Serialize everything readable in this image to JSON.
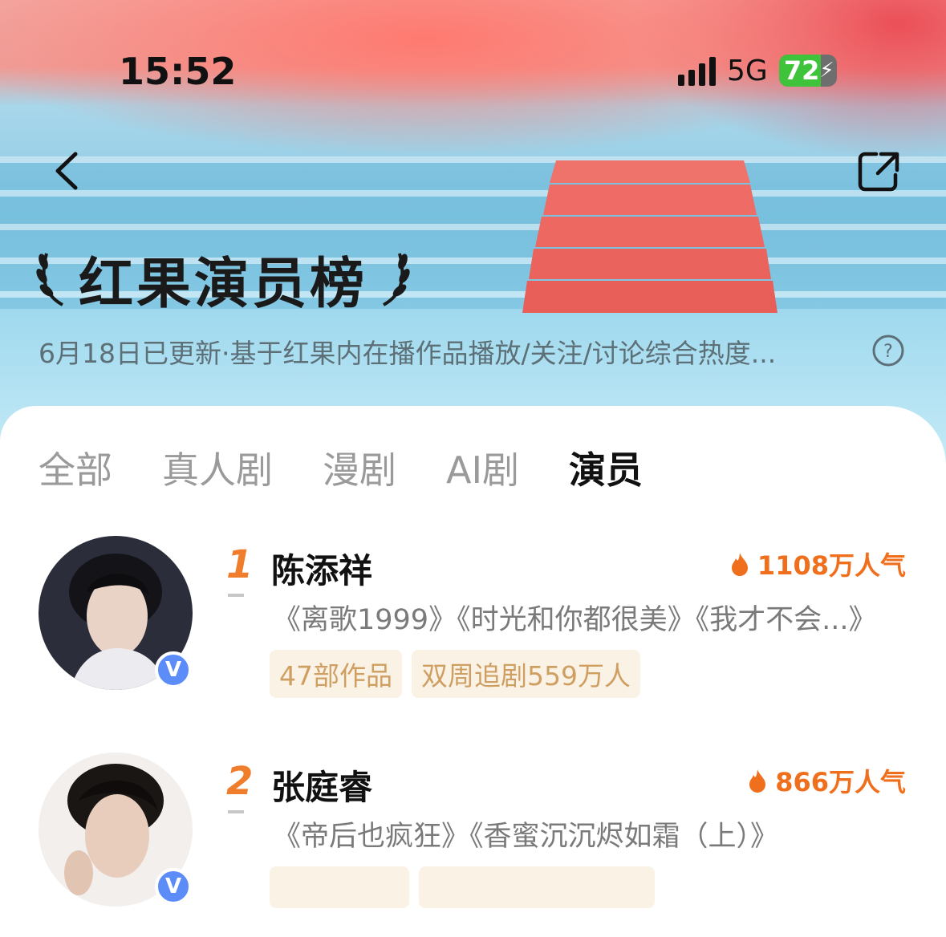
{
  "status_bar": {
    "time": "15:52",
    "network": "5G",
    "battery": "72"
  },
  "header": {
    "title": "红果演员榜",
    "subtitle": "6月18日已更新·基于红果内在播作品播放/关注/讨论综合热度..."
  },
  "tabs": [
    {
      "label": "全部",
      "active": false
    },
    {
      "label": "真人剧",
      "active": false
    },
    {
      "label": "漫剧",
      "active": false
    },
    {
      "label": "AI剧",
      "active": false
    },
    {
      "label": "演员",
      "active": true
    }
  ],
  "actors": [
    {
      "rank": "1",
      "name": "陈添祥",
      "heat": "1108万人气",
      "works": "《离歌1999》《时光和你都很美》《我才不会...》",
      "tags": [
        "47部作品",
        "双周追剧559万人"
      ],
      "verified_badge": "V"
    },
    {
      "rank": "2",
      "name": "张庭睿",
      "heat": "866万人气",
      "works": "《帝后也疯狂》《香蜜沉沉烬如霜（上）》",
      "tags": [
        "",
        ""
      ],
      "verified_badge": "V"
    }
  ],
  "colors": {
    "accent_orange": "#ef7d2c",
    "tag_bg": "#fbf2e6",
    "tag_text": "#cf9f62",
    "badge_blue": "#5b8cf7"
  },
  "icons": {
    "back": "chevron-left-icon",
    "share": "share-icon",
    "help": "question-circle-icon",
    "heat": "flame-icon",
    "laurel": "laurel-icon"
  }
}
